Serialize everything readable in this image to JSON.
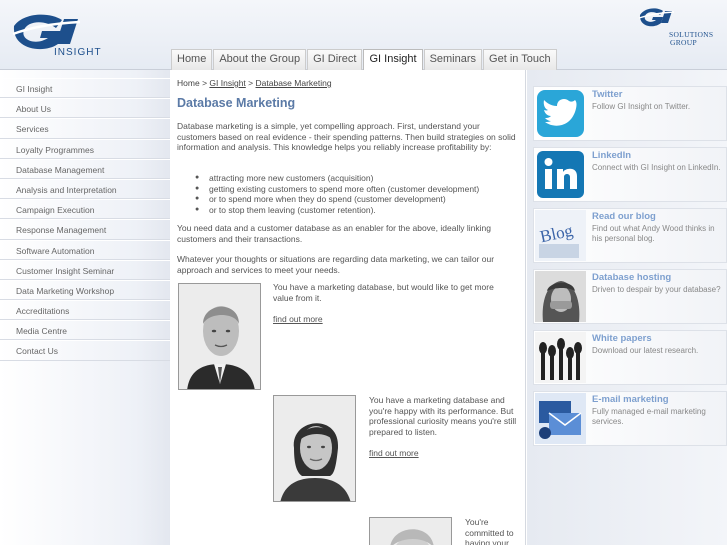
{
  "brand": {
    "left_logo_text": "GI",
    "left_logo_sub": "INSIGHT",
    "right_logo_text": "GI",
    "right_logo_sub1": "SOLUTIONS",
    "right_logo_sub2": "GROUP"
  },
  "nav": [
    {
      "label": "Home"
    },
    {
      "label": "About the Group"
    },
    {
      "label": "GI Direct"
    },
    {
      "label": "GI Insight",
      "active": true
    },
    {
      "label": "Seminars"
    },
    {
      "label": "Get in Touch"
    }
  ],
  "sidebar": [
    {
      "label": "GI Insight"
    },
    {
      "label": "About Us"
    },
    {
      "label": "Services"
    },
    {
      "label": "Loyalty Programmes"
    },
    {
      "label": "Database Management"
    },
    {
      "label": "Analysis and Interpretation"
    },
    {
      "label": "Campaign Execution"
    },
    {
      "label": "Response Management"
    },
    {
      "label": "Software Automation"
    },
    {
      "label": "Customer Insight Seminar"
    },
    {
      "label": "Data Marketing Workshop"
    },
    {
      "label": "Accreditations"
    },
    {
      "label": "Media Centre"
    },
    {
      "label": "Contact Us"
    }
  ],
  "breadcrumb": {
    "home": "Home",
    "sep": ">",
    "section": "GI Insight",
    "page": "Database Marketing"
  },
  "page": {
    "title": "Database Marketing",
    "intro": "Database marketing is a simple, yet compelling approach.  First, understand your customers based on real evidence - their spending patterns.  Then build strategies on solid information and analysis.  This knowledge helps you reliably increase profitability by:",
    "bullets": [
      "attracting more new customers (acquisition)",
      "getting existing customers to spend more often (customer development)",
      "or to spend more when they do spend (customer development)",
      "or to stop them leaving (customer retention)."
    ],
    "para2": "You need data and a customer database as an enabler for the above, ideally linking customers and their transactions.",
    "para3": "Whatever your thoughts or situations are regarding data marketing, we can tailor our approach and services to meet your needs.",
    "profiles": [
      {
        "text": "You have a marketing database, but would like to get more value from it.",
        "link": "find out more"
      },
      {
        "text": "You have a marketing database and you're happy with its performance. But professional curiosity means you're still prepared to listen.",
        "link": "find out more"
      },
      {
        "text": "You're committed to having your",
        "link": ""
      }
    ]
  },
  "promos": [
    {
      "title": "Twitter",
      "desc": "Follow GI Insight on Twitter.",
      "icon": "twitter-bird-icon",
      "color": "#2aa6d8"
    },
    {
      "title": "LinkedIn",
      "desc": "Connect with GI Insight on LinkedIn.",
      "icon": "linkedin-icon",
      "color": "#1477b4"
    },
    {
      "title": "Read our blog",
      "desc": "Find out what Andy Wood thinks in his personal blog.",
      "icon": "blog-icon",
      "thumb_text": "Blog"
    },
    {
      "title": "Database hosting",
      "desc": "Driven to despair by your database?",
      "icon": "despair-photo"
    },
    {
      "title": "White papers",
      "desc": "Download our latest research.",
      "icon": "microphones-photo"
    },
    {
      "title": "E-mail marketing",
      "desc": "Fully managed e-mail marketing services.",
      "icon": "email-photo"
    }
  ],
  "colors": {
    "accent": "#5b7aa6",
    "promo_title": "#7ea0cf",
    "logo_blue": "#1d4f8c"
  }
}
